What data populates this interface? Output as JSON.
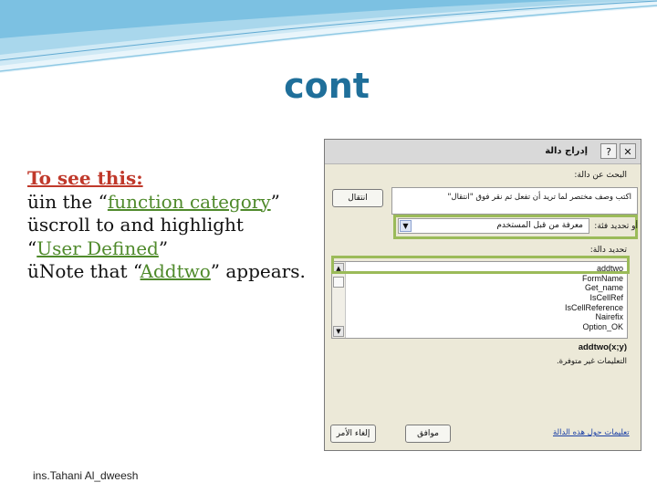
{
  "slide": {
    "title": "cont",
    "lines": [
      {
        "prefix": "",
        "link": "To see this:",
        "suffix": ""
      },
      {
        "prefix": "üin the “",
        "link": "function category",
        "suffix": "”"
      },
      {
        "prefix": "üscroll to and highlight",
        "link": "",
        "suffix": ""
      },
      {
        "prefix": " “",
        "link": "User Defined",
        "suffix": "”"
      },
      {
        "prefix": "üNote that “",
        "link": "Addtwo",
        "suffix": "” appears."
      }
    ],
    "footer": "ins.Tahani Al_dweesh"
  },
  "dialog": {
    "title": "إدراج دالة",
    "help_glyph": "?",
    "close_glyph": "✕",
    "search_label": "البحث عن دالة:",
    "search_text": "اكتب وصف مختصر لما تريد أن تفعل ثم نقر فوق \"انتقال\"",
    "go_button": "انتقال",
    "category_label": "أو تحديد فئة:",
    "category_value": "معرفة من قبل المستخدم",
    "select_label": "تحديد دالة:",
    "functions": [
      "addtwo",
      "FormName",
      "Get_name",
      "IsCellRef",
      "IsCellReference",
      "Nairefix",
      "Option_OK"
    ],
    "syntax": "addtwo(x;y)",
    "description": "التعليمات غير متوفرة.",
    "help_link": "تعليمات حول هذه الدالة",
    "ok_button": "موافق",
    "cancel_button": "إلغاء الأمر",
    "accent_color": "#9bbb59",
    "title_color": "#1f6f9a"
  }
}
